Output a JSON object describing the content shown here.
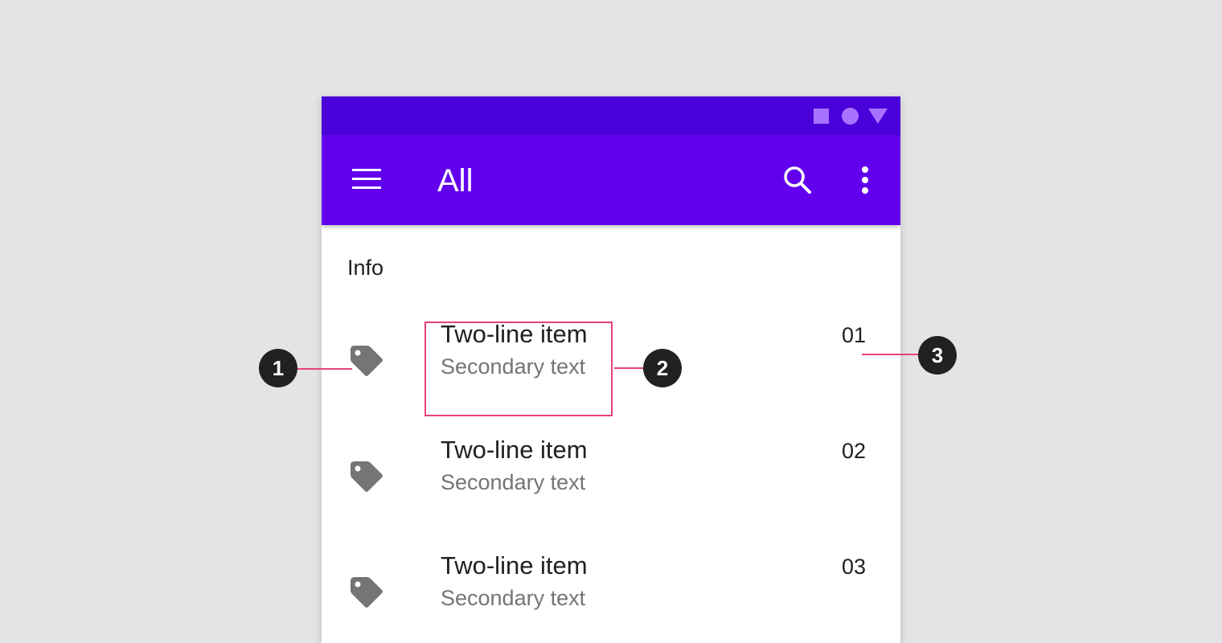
{
  "status_bar": {
    "icons": [
      "square-icon",
      "circle-icon",
      "triangle-icon"
    ],
    "color": "#4a00d9",
    "icon_color": "#a772ff"
  },
  "app_bar": {
    "title": "All",
    "color": "#6200ee",
    "icons": [
      "menu-icon",
      "search-icon",
      "more-vert-icon"
    ]
  },
  "list": {
    "subheader": "Info",
    "items": [
      {
        "icon": "tag-icon",
        "primary": "Two-line item",
        "secondary": "Secondary text",
        "meta": "01"
      },
      {
        "icon": "tag-icon",
        "primary": "Two-line item",
        "secondary": "Secondary text",
        "meta": "02"
      },
      {
        "icon": "tag-icon",
        "primary": "Two-line item",
        "secondary": "Secondary text",
        "meta": "03"
      }
    ]
  },
  "callouts": {
    "labels": [
      "1",
      "2",
      "3"
    ],
    "color": "#e8417a",
    "badge_color": "#212121"
  }
}
